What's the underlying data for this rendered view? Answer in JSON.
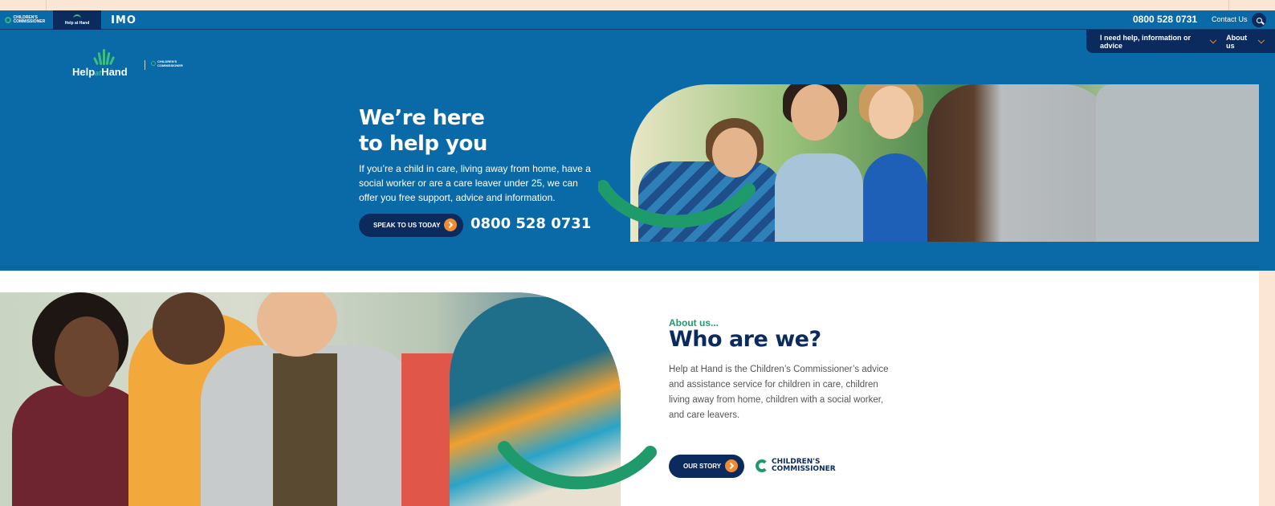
{
  "topbar": {
    "brand_tabs": [
      {
        "label": "CHILDREN'S COMMISSIONER"
      },
      {
        "label": "Help at Hand"
      },
      {
        "label": "IMO"
      }
    ],
    "phone": "0800 528 0731",
    "contact_label": "Contact Us"
  },
  "nav": {
    "items": [
      {
        "label": "I need help, information or advice"
      },
      {
        "label": "About us"
      }
    ]
  },
  "logo": {
    "main": "Help",
    "mid": "at",
    "end": "Hand",
    "partner": "CHILDREN'S COMMISSIONER"
  },
  "hero": {
    "title_line1": "We’re here",
    "title_line2": "to help you",
    "body": "If you’re a child in care, living away from home, have a social worker or are a care leaver under 25, we can offer you free support, advice and information.",
    "cta_label": "SPEAK TO US TODAY",
    "phone": "0800 528 0731"
  },
  "about": {
    "kicker": "About us...",
    "title": "Who are we?",
    "body": "Help at Hand is the Children’s Commissioner’s advice and assistance service for children in care, children living away from home, children with a social worker, and care leavers.",
    "cta_label": "OUR STORY",
    "partner_line1": "CHILDREN'S",
    "partner_line2": "COMMISSIONER"
  },
  "colors": {
    "primary_blue": "#0a6aa8",
    "navy": "#0b2a5e",
    "accent_green": "#1f9a6a",
    "accent_orange": "#f28b30"
  }
}
